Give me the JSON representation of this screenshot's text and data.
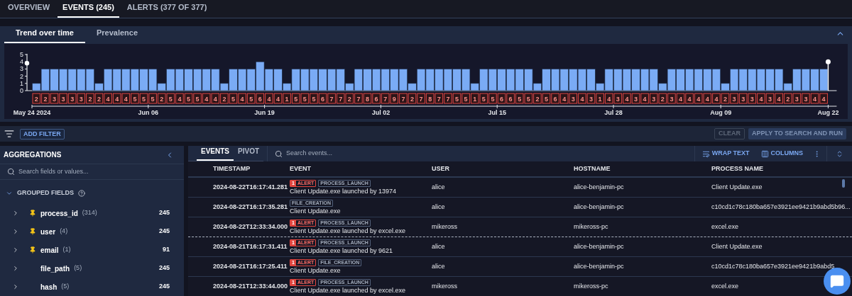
{
  "top_tabs": [
    {
      "label": "OVERVIEW",
      "selected": false
    },
    {
      "label": "EVENTS (245)",
      "selected": true
    },
    {
      "label": "ALERTS (377 OF 377)",
      "selected": false
    }
  ],
  "trend_panel": {
    "tabs": [
      {
        "label": "Trend over time",
        "selected": true
      },
      {
        "label": "Prevalence",
        "selected": false
      }
    ],
    "expanded": true,
    "chart_data": {
      "type": "bar",
      "categories": [
        "May 24 2024",
        null,
        null,
        null,
        null,
        null,
        null,
        null,
        null,
        null,
        null,
        null,
        null,
        "Jun 06",
        null,
        null,
        null,
        null,
        null,
        null,
        null,
        null,
        null,
        null,
        null,
        null,
        "Jun 19",
        null,
        null,
        null,
        null,
        null,
        null,
        null,
        null,
        null,
        null,
        null,
        null,
        "Jul 02",
        null,
        null,
        null,
        null,
        null,
        null,
        null,
        null,
        null,
        null,
        null,
        null,
        "Jul 15",
        null,
        null,
        null,
        null,
        null,
        null,
        null,
        null,
        null,
        null,
        null,
        null,
        "Jul 28",
        null,
        null,
        null,
        null,
        null,
        null,
        null,
        null,
        null,
        null,
        null,
        "Aug 09",
        null,
        null,
        null,
        null,
        null,
        null,
        null,
        null,
        null,
        null,
        "Aug 22"
      ],
      "values": [
        1,
        3,
        3,
        3,
        3,
        3,
        3,
        1,
        3,
        3,
        3,
        3,
        3,
        3,
        1,
        3,
        3,
        3,
        3,
        3,
        3,
        1,
        3,
        3,
        3,
        4,
        3,
        3,
        1,
        3,
        3,
        3,
        3,
        3,
        3,
        1,
        3,
        3,
        3,
        3,
        3,
        3,
        1,
        3,
        3,
        3,
        3,
        3,
        3,
        1,
        3,
        3,
        3,
        3,
        3,
        3,
        1,
        3,
        3,
        3,
        3,
        3,
        3,
        1,
        3,
        3,
        3,
        3,
        3,
        3,
        1,
        3,
        3,
        3,
        3,
        3,
        3,
        1,
        3,
        3,
        3,
        3,
        3,
        3,
        1,
        3,
        3,
        3,
        3
      ],
      "ylim": [
        0,
        5
      ],
      "yticks": [
        0,
        1,
        2,
        3,
        4,
        5
      ]
    },
    "alert_counts": [
      "2",
      "2",
      "3",
      "3",
      "3",
      "3",
      "2",
      "2",
      "4",
      "4",
      "4",
      "5",
      "5",
      "5",
      "2",
      "5",
      "4",
      "5",
      "5",
      "4",
      "4",
      "2",
      "5",
      "4",
      "5",
      "6",
      "4",
      "4",
      "1",
      "5",
      "5",
      "5",
      "6",
      "7",
      "7",
      "2",
      "7",
      "8",
      "6",
      "7",
      "9",
      "7",
      "2",
      "7",
      "8",
      "7",
      "7",
      "5",
      "5",
      "1",
      "5",
      "5",
      "6",
      "6",
      "5",
      "5",
      "2",
      "5",
      "6",
      "4",
      "3",
      "4",
      "3",
      "1",
      "4",
      "3",
      "4",
      "3",
      "4",
      "3",
      "2",
      "3",
      "4",
      "4",
      "4",
      "4",
      "4",
      "2",
      "3",
      "3",
      "3",
      "4",
      "3",
      "4",
      "2",
      "3",
      "3",
      "4",
      "4"
    ]
  },
  "filter_bar": {
    "add_filter": "ADD FILTER",
    "clear": {
      "label": "CLEAR",
      "disabled": true
    },
    "apply": {
      "label": "APPLY TO SEARCH AND RUN"
    }
  },
  "aggregations": {
    "title": "AGGREGATIONS",
    "search": {
      "placeholder": "Search fields or values..."
    },
    "group": {
      "label": "GROUPED FIELDS",
      "expanded": true,
      "fields": [
        {
          "name": "process_id",
          "count": "(314)",
          "total": "245",
          "pinned": true,
          "expanded": false
        },
        {
          "name": "user",
          "count": "(4)",
          "total": "245",
          "pinned": true,
          "expanded": false
        },
        {
          "name": "email",
          "count": "(1)",
          "total": "91",
          "pinned": true,
          "expanded": false
        },
        {
          "name": "file_path",
          "count": "(5)",
          "total": "245",
          "pinned": false,
          "expanded": false
        },
        {
          "name": "hash",
          "count": "(5)",
          "total": "245",
          "pinned": false,
          "expanded": false
        }
      ]
    }
  },
  "events": {
    "tabs": [
      {
        "label": "EVENTS",
        "selected": true
      },
      {
        "label": "PIVOT",
        "selected": false
      }
    ],
    "search": {
      "placeholder": "Search events..."
    },
    "toolbar": [
      {
        "kind": "wrap",
        "label": "WRAP TEXT"
      },
      {
        "kind": "columns",
        "label": "COLUMNS"
      },
      {
        "kind": "more"
      },
      {
        "kind": "density"
      }
    ],
    "columns": [
      "TIMESTAMP",
      "EVENT",
      "USER",
      "HOSTNAME",
      "PROCESS NAME"
    ],
    "rows": [
      {
        "timestamp": "2024-08-22T16:17:41.281",
        "alert": {
          "count": "1",
          "label": "ALERT"
        },
        "event_type": "PROCESS_LAUNCH",
        "description": "Client Update.exe launched by 13974",
        "user": "alice",
        "hostname": "alice-benjamin-pc",
        "process_name": "Client Update.exe",
        "day_start": false
      },
      {
        "timestamp": "2024-08-22T16:17:35.281",
        "event_type": "FILE_CREATION",
        "description": "Client Update.exe",
        "user": "alice",
        "hostname": "alice-benjamin-pc",
        "process_name": "c10cd1c78c180ba657e3921ee9421b9abd5b96...",
        "day_start": false
      },
      {
        "timestamp": "2024-08-22T12:33:34.000",
        "alert": {
          "count": "1",
          "label": "ALERT"
        },
        "event_type": "PROCESS_LAUNCH",
        "description": "Client Update.exe launched by excel.exe",
        "user": "mikeross",
        "hostname": "mikeross-pc",
        "process_name": "excel.exe",
        "day_start": false
      },
      {
        "timestamp": "2024-08-21T16:17:31.411",
        "alert": {
          "count": "1",
          "label": "ALERT"
        },
        "event_type": "PROCESS_LAUNCH",
        "description": "Client Update.exe launched by 9621",
        "user": "alice",
        "hostname": "alice-benjamin-pc",
        "process_name": "Client Update.exe",
        "day_start": true
      },
      {
        "timestamp": "2024-08-21T16:17:25.411",
        "alert": {
          "count": "1",
          "label": "ALERT"
        },
        "event_type": "FILE_CREATION",
        "description": "Client Update.exe",
        "user": "alice",
        "hostname": "alice-benjamin-pc",
        "process_name": "c10cd1c78c180ba657e3921ee9421b9abd5",
        "day_start": false
      },
      {
        "timestamp": "2024-08-21T12:33:44.000",
        "alert": {
          "count": "1",
          "label": "ALERT"
        },
        "event_type": "PROCESS_LAUNCH",
        "description": "Client Update.exe launched by excel.exe",
        "user": "mikeross",
        "hostname": "mikeross-pc",
        "process_name": "excel.exe",
        "day_start": false
      }
    ]
  }
}
